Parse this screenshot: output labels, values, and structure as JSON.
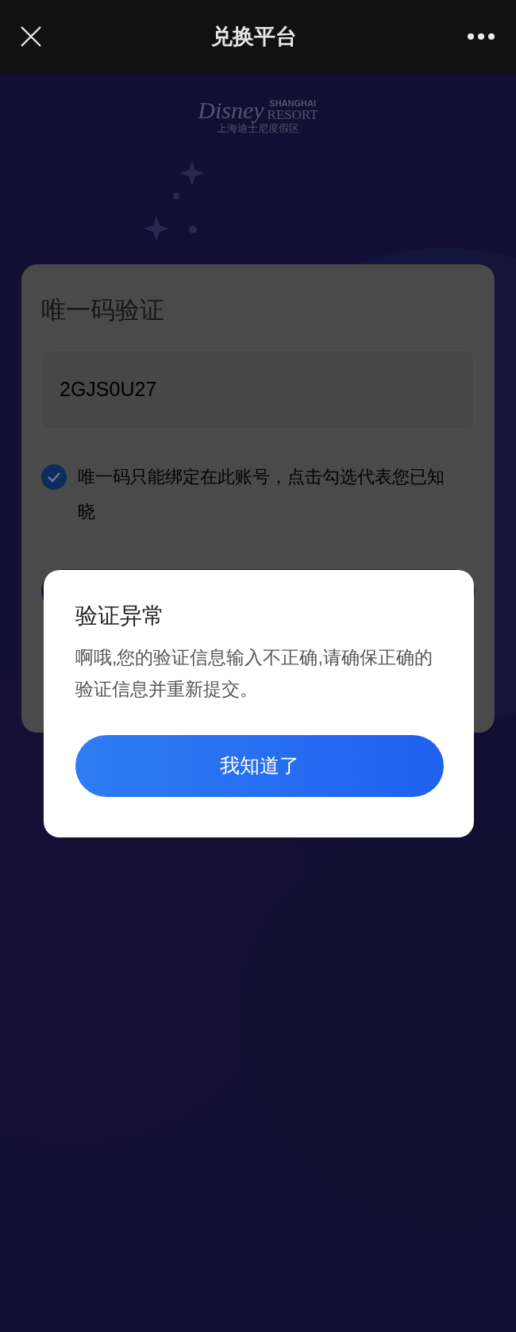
{
  "header": {
    "title": "兑换平台"
  },
  "logo": {
    "top": "SHANGHAI",
    "script": "Disney",
    "word": "RESORT",
    "chinese": "上海迪士尼度假区"
  },
  "card": {
    "title": "唯一码验证",
    "code_field": {
      "value": "2GJS0U27"
    },
    "agreement": {
      "checked": true,
      "text": "唯一码只能绑定在此账号，点击勾选代表您已知晓"
    }
  },
  "dialog": {
    "title": "验证异常",
    "message": "啊哦,您的验证信息输入不正确,请确保正确的验证信息并重新提交。",
    "button": "我知道了"
  }
}
